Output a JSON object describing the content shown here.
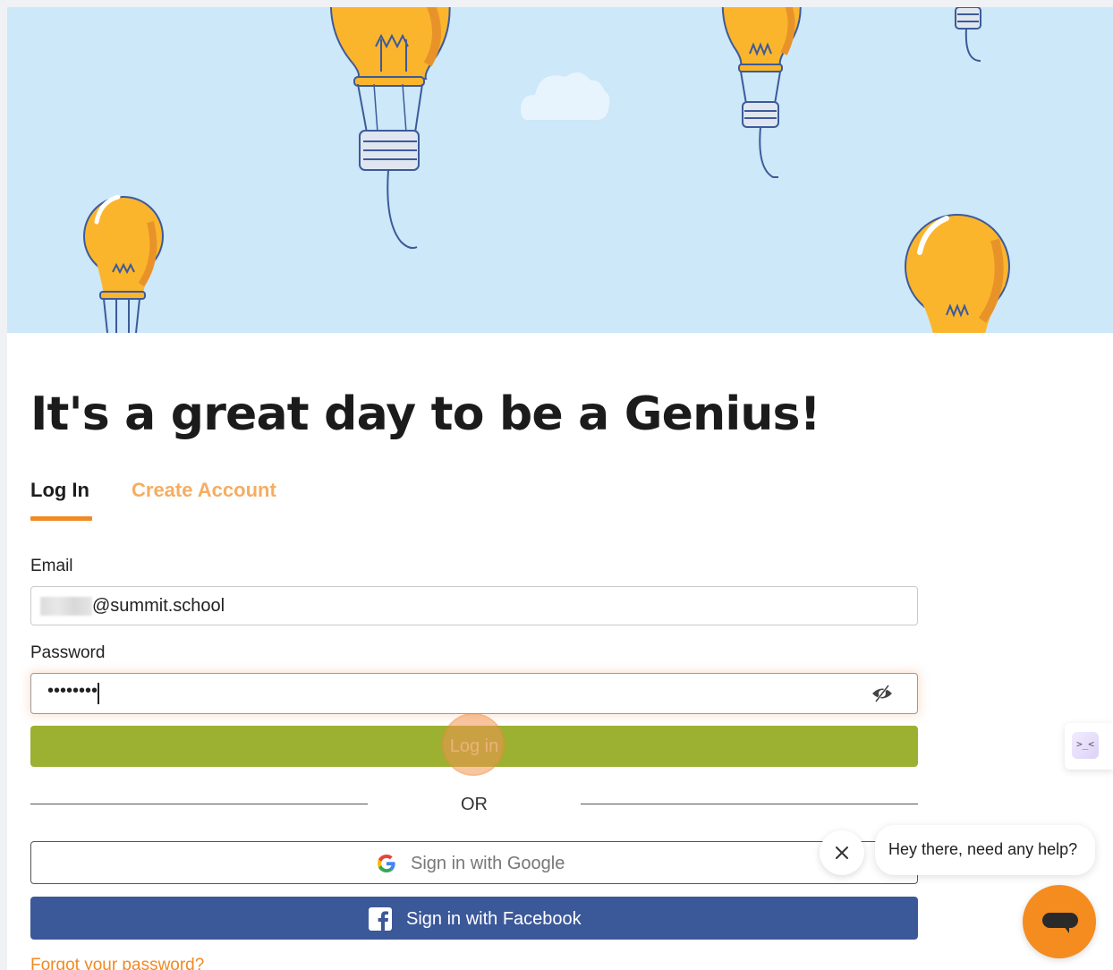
{
  "headline": "It's a great day to be a Genius!",
  "tabs": {
    "login": "Log In",
    "create": "Create Account"
  },
  "form": {
    "email_label": "Email",
    "email_value": "@summit.school",
    "password_label": "Password",
    "password_value": "••••••••",
    "login_button": "Log in",
    "or": "OR",
    "google_button": "Sign in with Google",
    "facebook_button": "Sign in with Facebook",
    "forgot_link": "Forgot your password?"
  },
  "chat": {
    "message": "Hey there, need any help?"
  },
  "side_widget": {
    "icon_text": ">_<"
  },
  "colors": {
    "accent": "#f08a24",
    "login_button": "#9cb032",
    "facebook": "#3b5899",
    "hero_sky": "#cce8f9"
  },
  "icons": [
    "lightbulb-illustration",
    "cloud-illustration",
    "eye-slash-icon",
    "google-g-icon",
    "facebook-f-icon",
    "close-icon",
    "chat-icon"
  ]
}
